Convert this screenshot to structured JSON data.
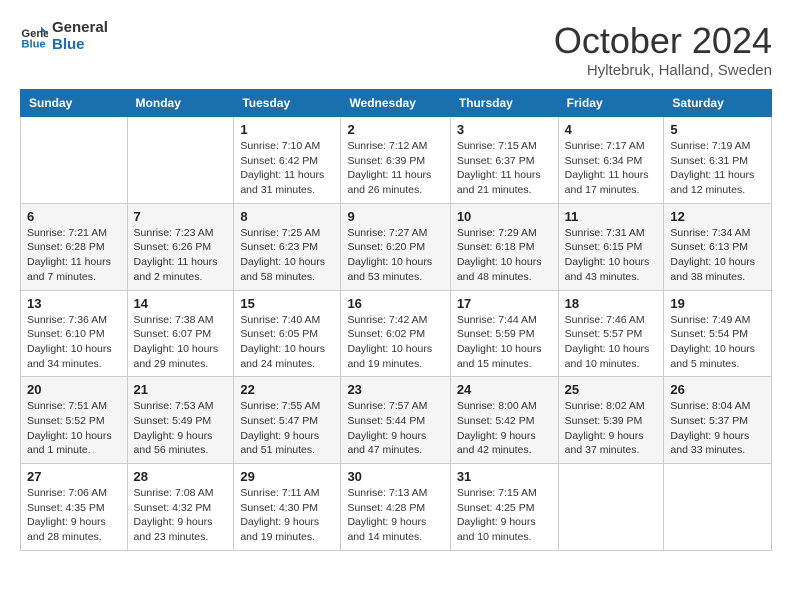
{
  "header": {
    "logo_line1": "General",
    "logo_line2": "Blue",
    "title": "October 2024",
    "subtitle": "Hyltebruk, Halland, Sweden"
  },
  "days_of_week": [
    "Sunday",
    "Monday",
    "Tuesday",
    "Wednesday",
    "Thursday",
    "Friday",
    "Saturday"
  ],
  "weeks": [
    [
      {
        "num": "",
        "info": ""
      },
      {
        "num": "",
        "info": ""
      },
      {
        "num": "1",
        "info": "Sunrise: 7:10 AM\nSunset: 6:42 PM\nDaylight: 11 hours and 31 minutes."
      },
      {
        "num": "2",
        "info": "Sunrise: 7:12 AM\nSunset: 6:39 PM\nDaylight: 11 hours and 26 minutes."
      },
      {
        "num": "3",
        "info": "Sunrise: 7:15 AM\nSunset: 6:37 PM\nDaylight: 11 hours and 21 minutes."
      },
      {
        "num": "4",
        "info": "Sunrise: 7:17 AM\nSunset: 6:34 PM\nDaylight: 11 hours and 17 minutes."
      },
      {
        "num": "5",
        "info": "Sunrise: 7:19 AM\nSunset: 6:31 PM\nDaylight: 11 hours and 12 minutes."
      }
    ],
    [
      {
        "num": "6",
        "info": "Sunrise: 7:21 AM\nSunset: 6:28 PM\nDaylight: 11 hours and 7 minutes."
      },
      {
        "num": "7",
        "info": "Sunrise: 7:23 AM\nSunset: 6:26 PM\nDaylight: 11 hours and 2 minutes."
      },
      {
        "num": "8",
        "info": "Sunrise: 7:25 AM\nSunset: 6:23 PM\nDaylight: 10 hours and 58 minutes."
      },
      {
        "num": "9",
        "info": "Sunrise: 7:27 AM\nSunset: 6:20 PM\nDaylight: 10 hours and 53 minutes."
      },
      {
        "num": "10",
        "info": "Sunrise: 7:29 AM\nSunset: 6:18 PM\nDaylight: 10 hours and 48 minutes."
      },
      {
        "num": "11",
        "info": "Sunrise: 7:31 AM\nSunset: 6:15 PM\nDaylight: 10 hours and 43 minutes."
      },
      {
        "num": "12",
        "info": "Sunrise: 7:34 AM\nSunset: 6:13 PM\nDaylight: 10 hours and 38 minutes."
      }
    ],
    [
      {
        "num": "13",
        "info": "Sunrise: 7:36 AM\nSunset: 6:10 PM\nDaylight: 10 hours and 34 minutes."
      },
      {
        "num": "14",
        "info": "Sunrise: 7:38 AM\nSunset: 6:07 PM\nDaylight: 10 hours and 29 minutes."
      },
      {
        "num": "15",
        "info": "Sunrise: 7:40 AM\nSunset: 6:05 PM\nDaylight: 10 hours and 24 minutes."
      },
      {
        "num": "16",
        "info": "Sunrise: 7:42 AM\nSunset: 6:02 PM\nDaylight: 10 hours and 19 minutes."
      },
      {
        "num": "17",
        "info": "Sunrise: 7:44 AM\nSunset: 5:59 PM\nDaylight: 10 hours and 15 minutes."
      },
      {
        "num": "18",
        "info": "Sunrise: 7:46 AM\nSunset: 5:57 PM\nDaylight: 10 hours and 10 minutes."
      },
      {
        "num": "19",
        "info": "Sunrise: 7:49 AM\nSunset: 5:54 PM\nDaylight: 10 hours and 5 minutes."
      }
    ],
    [
      {
        "num": "20",
        "info": "Sunrise: 7:51 AM\nSunset: 5:52 PM\nDaylight: 10 hours and 1 minute."
      },
      {
        "num": "21",
        "info": "Sunrise: 7:53 AM\nSunset: 5:49 PM\nDaylight: 9 hours and 56 minutes."
      },
      {
        "num": "22",
        "info": "Sunrise: 7:55 AM\nSunset: 5:47 PM\nDaylight: 9 hours and 51 minutes."
      },
      {
        "num": "23",
        "info": "Sunrise: 7:57 AM\nSunset: 5:44 PM\nDaylight: 9 hours and 47 minutes."
      },
      {
        "num": "24",
        "info": "Sunrise: 8:00 AM\nSunset: 5:42 PM\nDaylight: 9 hours and 42 minutes."
      },
      {
        "num": "25",
        "info": "Sunrise: 8:02 AM\nSunset: 5:39 PM\nDaylight: 9 hours and 37 minutes."
      },
      {
        "num": "26",
        "info": "Sunrise: 8:04 AM\nSunset: 5:37 PM\nDaylight: 9 hours and 33 minutes."
      }
    ],
    [
      {
        "num": "27",
        "info": "Sunrise: 7:06 AM\nSunset: 4:35 PM\nDaylight: 9 hours and 28 minutes."
      },
      {
        "num": "28",
        "info": "Sunrise: 7:08 AM\nSunset: 4:32 PM\nDaylight: 9 hours and 23 minutes."
      },
      {
        "num": "29",
        "info": "Sunrise: 7:11 AM\nSunset: 4:30 PM\nDaylight: 9 hours and 19 minutes."
      },
      {
        "num": "30",
        "info": "Sunrise: 7:13 AM\nSunset: 4:28 PM\nDaylight: 9 hours and 14 minutes."
      },
      {
        "num": "31",
        "info": "Sunrise: 7:15 AM\nSunset: 4:25 PM\nDaylight: 9 hours and 10 minutes."
      },
      {
        "num": "",
        "info": ""
      },
      {
        "num": "",
        "info": ""
      }
    ]
  ]
}
